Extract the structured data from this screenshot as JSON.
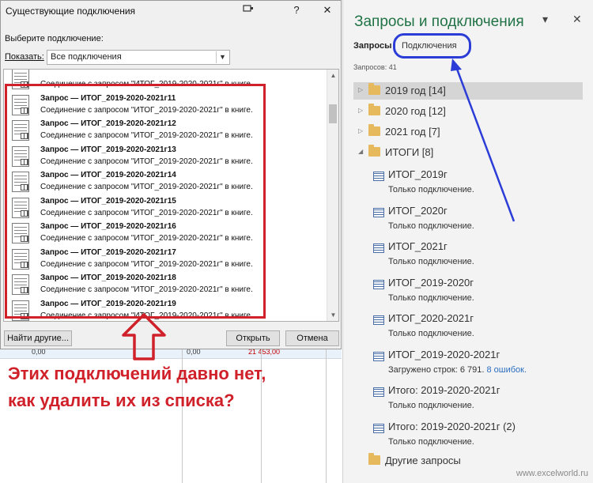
{
  "dialog": {
    "title": "Существующие подключения",
    "pin_icon": "pin-icon",
    "help_label": "?",
    "close_label": "✕",
    "choose_label": "Выберите подключение:",
    "show_label": "Показать:",
    "show_value": "Все подключения",
    "items": [
      {
        "name": "",
        "desc": "Соединение с запросом \"ИТОГ_2019-2020-2021г\" в книге."
      },
      {
        "name": "Запрос — ИТОГ_2019-2020-2021г11",
        "desc": "Соединение с запросом \"ИТОГ_2019-2020-2021г\" в книге."
      },
      {
        "name": "Запрос — ИТОГ_2019-2020-2021г12",
        "desc": "Соединение с запросом \"ИТОГ_2019-2020-2021г\" в книге."
      },
      {
        "name": "Запрос — ИТОГ_2019-2020-2021г13",
        "desc": "Соединение с запросом \"ИТОГ_2019-2020-2021г\" в книге."
      },
      {
        "name": "Запрос — ИТОГ_2019-2020-2021г14",
        "desc": "Соединение с запросом \"ИТОГ_2019-2020-2021г\" в книге."
      },
      {
        "name": "Запрос — ИТОГ_2019-2020-2021г15",
        "desc": "Соединение с запросом \"ИТОГ_2019-2020-2021г\" в книге."
      },
      {
        "name": "Запрос — ИТОГ_2019-2020-2021г16",
        "desc": "Соединение с запросом \"ИТОГ_2019-2020-2021г\" в книге."
      },
      {
        "name": "Запрос — ИТОГ_2019-2020-2021г17",
        "desc": "Соединение с запросом \"ИТОГ_2019-2020-2021г\" в книге."
      },
      {
        "name": "Запрос — ИТОГ_2019-2020-2021г18",
        "desc": "Соединение с запросом \"ИТОГ_2019-2020-2021г\" в книге."
      },
      {
        "name": "Запрос — ИТОГ_2019-2020-2021г19",
        "desc": "Соединение с запросом \"ИТОГ_2019-2020-2021г\" в книге."
      }
    ],
    "browse_button": "Найти другие...",
    "open_button": "Открыть",
    "cancel_button": "Отмена"
  },
  "sheet": {
    "values": [
      "0,00",
      "0,00",
      "21 453,00"
    ]
  },
  "annotation": {
    "line1": "Этих подключений давно нет,",
    "line2": "как удалить их из списка?",
    "color": "#d0202a"
  },
  "pane": {
    "title": "Запросы и подключения",
    "title_color": "#217346",
    "options_icon": "▾",
    "close_icon": "✕",
    "tabs": [
      "Запросы",
      "Подключения"
    ],
    "count": "Запросов: 41",
    "groups": [
      {
        "label": "2019 год [14]",
        "expanded": false,
        "selected": true
      },
      {
        "label": "2020 год [12]",
        "expanded": false,
        "selected": false
      },
      {
        "label": "2021 год [7]",
        "expanded": false,
        "selected": false
      },
      {
        "label": "ИТОГИ [8]",
        "expanded": true,
        "selected": false
      }
    ],
    "queries": [
      {
        "name": "ИТОГ_2019г",
        "status": "Только подключение."
      },
      {
        "name": "ИТОГ_2020г",
        "status": "Только подключение."
      },
      {
        "name": "ИТОГ_2021г",
        "status": "Только подключение."
      },
      {
        "name": "ИТОГ_2019-2020г",
        "status": "Только подключение."
      },
      {
        "name": "ИТОГ_2020-2021г",
        "status": "Только подключение."
      },
      {
        "name": "ИТОГ_2019-2020-2021г",
        "status": "Загружено строк: 6 791.",
        "errors": "8 ошибок."
      },
      {
        "name": "Итого: 2019-2020-2021г",
        "status": "Только подключение."
      },
      {
        "name": "Итого: 2019-2020-2021г (2)",
        "status": "Только подключение."
      }
    ],
    "other_group": "Другие запросы"
  },
  "watermark": "www.excelworld.ru",
  "arrow_color": "#2b3dd6"
}
